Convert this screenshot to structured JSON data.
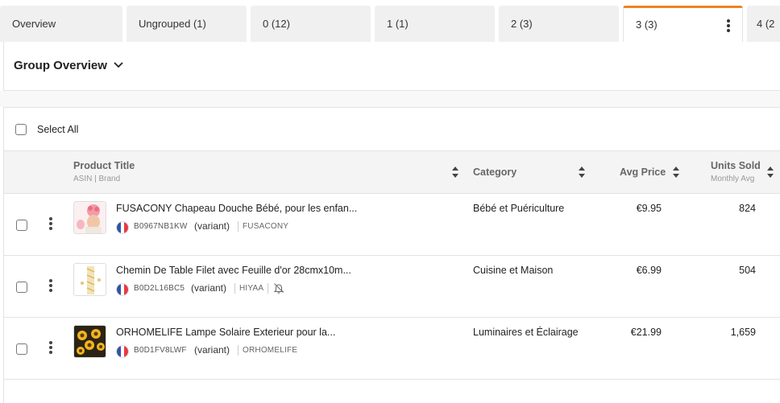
{
  "tabs": [
    {
      "label": "Overview",
      "active": false
    },
    {
      "label": "Ungrouped (1)",
      "active": false
    },
    {
      "label": "0 (12)",
      "active": false
    },
    {
      "label": "1 (1)",
      "active": false
    },
    {
      "label": "2 (3)",
      "active": false
    },
    {
      "label": "3 (3)",
      "active": true
    },
    {
      "label": "4 (2",
      "active": false
    }
  ],
  "group": {
    "title": "Group Overview"
  },
  "table": {
    "select_all_label": "Select All",
    "columns": {
      "product_title": "Product Title",
      "product_sub": "ASIN | Brand",
      "category": "Category",
      "avg_price": "Avg Price",
      "units_sold": "Units Sold",
      "units_sub": "Monthly Avg"
    },
    "rows": [
      {
        "title": "FUSACONY Chapeau Douche Bébé, pour les enfan...",
        "asin": "B0967NB1KW",
        "variant": "(variant)",
        "brand": "FUSACONY",
        "category": "Bébé et Puériculture",
        "price": "€9.95",
        "units": "824",
        "image": "pink-shower-cap-thumbnail",
        "muted": false
      },
      {
        "title": "Chemin De Table Filet avec Feuille d'or 28cmx10m...",
        "asin": "B0D2L16BC5",
        "variant": "(variant)",
        "brand": "HIYAA",
        "category": "Cuisine et Maison",
        "price": "€6.99",
        "units": "504",
        "image": "gold-table-runner-thumbnail",
        "muted": true
      },
      {
        "title": "ORHOMELIFE Lampe Solaire Exterieur pour la...",
        "asin": "B0D1FV8LWF",
        "variant": "(variant)",
        "brand": "ORHOMELIFE",
        "category": "Luminaires et Éclairage",
        "price": "€21.99",
        "units": "1,659",
        "image": "sunflower-solar-lamp-thumbnail",
        "muted": false
      }
    ]
  },
  "colors": {
    "accent": "#f0821e",
    "flag_blue": "#2f55a4",
    "flag_red": "#e63946"
  }
}
